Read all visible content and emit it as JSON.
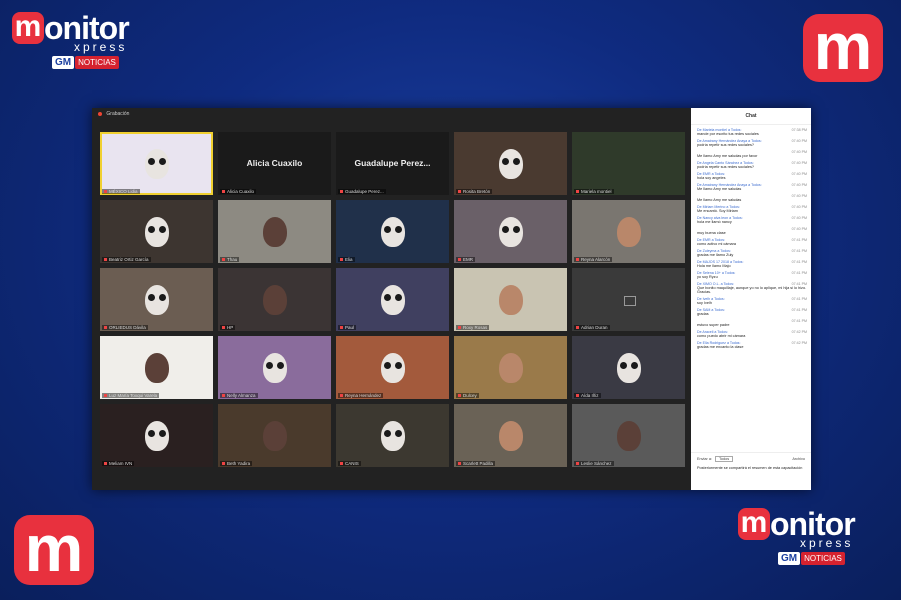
{
  "brand": {
    "logo_m": "m",
    "logo_rest": "onitor",
    "tagline": "xpress",
    "gm": "GM",
    "noticias": "NOTICIAS",
    "accent": "#e8313e",
    "background": "#0f2b80"
  },
  "zoom": {
    "recording_label": "Grabación",
    "participants": [
      {
        "name": "MÉXICO Lidia",
        "video": true,
        "face": "skull",
        "bg": "#e9e4f0",
        "active": true
      },
      {
        "name": "Alicia Cuaxilo",
        "video": false,
        "face": "hidden",
        "bg": "#1a1a1a",
        "active": false
      },
      {
        "name": "Guadalupe  Perez...",
        "video": false,
        "face": "hidden",
        "bg": "#1a1a1a",
        "active": false
      },
      {
        "name": "Rosita Bretón",
        "video": true,
        "face": "skull",
        "bg": "#4a3a30",
        "active": false
      },
      {
        "name": "Mariela montiel",
        "video": true,
        "face": "hidden",
        "bg": "#2f3a2a",
        "active": false
      },
      {
        "name": "Beatriz Ortiz García",
        "video": true,
        "face": "skull",
        "bg": "#3d3530",
        "active": false
      },
      {
        "name": "Thau",
        "video": true,
        "face": "dark",
        "bg": "#8d8a82",
        "active": false
      },
      {
        "name": "Elia",
        "video": true,
        "face": "skull",
        "bg": "#20304a",
        "active": false
      },
      {
        "name": "EMR",
        "video": true,
        "face": "skull",
        "bg": "#6a6068",
        "active": false
      },
      {
        "name": "Reyna Alarcón",
        "video": true,
        "face": "plain",
        "bg": "#7a7670",
        "active": false
      },
      {
        "name": "ORLIEDUS Dávila",
        "video": true,
        "face": "skull",
        "bg": "#6b5d52",
        "active": false
      },
      {
        "name": "HP",
        "video": true,
        "face": "dark",
        "bg": "#3b3434",
        "active": false
      },
      {
        "name": "Paul",
        "video": true,
        "face": "skull",
        "bg": "#404060",
        "active": false
      },
      {
        "name": "Roxy Rosas",
        "video": true,
        "face": "plain",
        "bg": "#c9c4b2",
        "active": false
      },
      {
        "name": "Adrian Duran",
        "video": false,
        "face": "hidden",
        "bg": "#3a3a3a",
        "active": false,
        "blocked": true
      },
      {
        "name": "Luz María Toxqui Varela",
        "video": true,
        "face": "dark",
        "bg": "#f0eeea",
        "active": false
      },
      {
        "name": "Nelly Almanza",
        "video": true,
        "face": "skull",
        "bg": "#8a6c9c",
        "active": false
      },
      {
        "name": "Reyna Hernández",
        "video": true,
        "face": "skull",
        "bg": "#a35a3c",
        "active": false
      },
      {
        "name": "Dulcey",
        "video": true,
        "face": "plain",
        "bg": "#9a7a4a",
        "active": false
      },
      {
        "name": "Aída Iñiz",
        "video": true,
        "face": "skull",
        "bg": "#3a3a44",
        "active": false
      },
      {
        "name": "Meliam IVN",
        "video": true,
        "face": "skull",
        "bg": "#2a2020",
        "active": false
      },
      {
        "name": "Beth Yadira",
        "video": true,
        "face": "dark",
        "bg": "#4a3a2c",
        "active": false
      },
      {
        "name": "CANIS",
        "video": true,
        "face": "skull",
        "bg": "#3c3830",
        "active": false
      },
      {
        "name": "Scarlett Padilla",
        "video": true,
        "face": "plain",
        "bg": "#6a6256",
        "active": false
      },
      {
        "name": "Leslie Sánchez",
        "video": true,
        "face": "dark",
        "bg": "#5a5a5a",
        "active": false
      }
    ]
  },
  "chat": {
    "title": "Chat",
    "messages": [
      {
        "from": "De Mariela montiel a Todos:",
        "time": "07:38 PM",
        "text": "mande por escrito tus redes sociales"
      },
      {
        "from": "De Amairany Hernández Anaya a Todos:",
        "time": "07:40 PM",
        "text": "podría repetir sus redes sociales?"
      },
      {
        "from": "",
        "time": "07:40 PM",
        "text": "Me llamo Amy me saludas por favor"
      },
      {
        "from": "De Angela Canto Sánchez a Todos:",
        "time": "07:40 PM",
        "text": "podría repetir sus redes sociales?"
      },
      {
        "from": "De EMR a Todos:",
        "time": "07:40 PM",
        "text": "hola soy angeles"
      },
      {
        "from": "De Amairany Hernández Anaya a Todos:",
        "time": "07:40 PM",
        "text": "Me llamo Amy me saludas"
      },
      {
        "from": "",
        "time": "07:40 PM",
        "text": "Me llamo Amy me saludas"
      },
      {
        "from": "De Miriam Merino a Todos:",
        "time": "07:40 PM",
        "text": "Me encantó. Soy Miriam"
      },
      {
        "from": "De Nancy alva leon a Todos:",
        "time": "07:40 PM",
        "text": "hola me llamó nancy"
      },
      {
        "from": "",
        "time": "07:40 PM",
        "text": "muy buena clase"
      },
      {
        "from": "De EMR a Todos:",
        "time": "07:41 PM",
        "text": "como activo mi cámara"
      },
      {
        "from": "De Zuleyma a Todos:",
        "time": "07:41 PM",
        "text": "gradas me llamo Zuly"
      },
      {
        "from": "De MAJOS 17 2018 a Todos:",
        "time": "07:41 PM",
        "text": "Hola me llamo Majo"
      },
      {
        "from": "De Selena 10+ a Todos:",
        "time": "07:41 PM",
        "text": "yo soy Ryzu"
      },
      {
        "from": "De XIMO O.L. a Todos:",
        "time": "07:41 PM",
        "text": "Que bonito maquillaje, aunque yo no lo aplique, mi hija si lo hizo. Gracias."
      },
      {
        "from": "De Ivelh a Todos:",
        "time": "07:41 PM",
        "text": "soy Ivelh"
      },
      {
        "from": "De SAM a Todos:",
        "time": "07:41 PM",
        "text": "gradas"
      },
      {
        "from": "",
        "time": "07:41 PM",
        "text": "estuvo super padre"
      },
      {
        "from": "De Araceli a Todos:",
        "time": "07:42 PM",
        "text": "como puedo abrir mi cámara"
      },
      {
        "from": "De Ella Rodriguez a Todos:",
        "time": "07:42 PM",
        "text": "gradas me encanto la clase"
      }
    ],
    "send_to_label": "Enviar a:",
    "send_to_value": "Todos",
    "file_button": "Archivo",
    "input_text": "Posteriormente se compartirá el resumen de esta capacitación"
  }
}
